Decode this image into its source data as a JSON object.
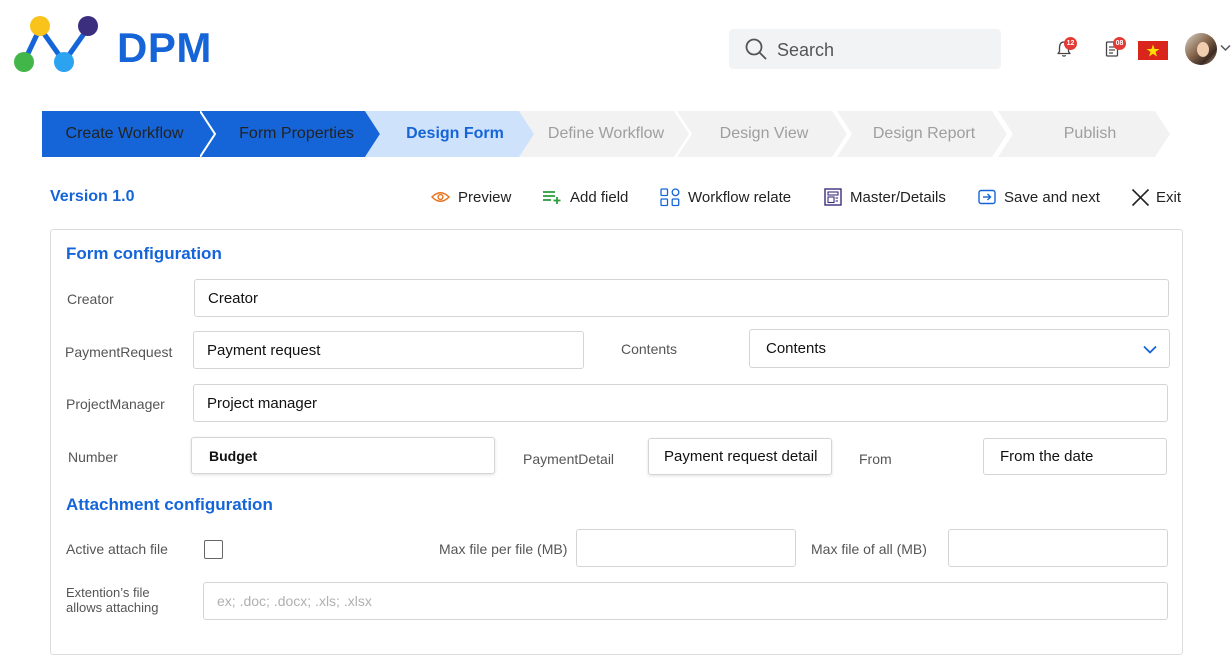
{
  "header": {
    "logo_text": "DPM",
    "search": {
      "placeholder": "Search"
    },
    "notifications": {
      "count": "12"
    },
    "documents": {
      "count": "08"
    },
    "language_flag": "vietnam-flag-icon",
    "user_avatar": "avatar"
  },
  "stepper": [
    {
      "label": "Create Workflow",
      "state": "done"
    },
    {
      "label": "Form Properties",
      "state": "done"
    },
    {
      "label": "Design Form",
      "state": "current"
    },
    {
      "label": "Define Workflow",
      "state": "todo"
    },
    {
      "label": "Design View",
      "state": "todo"
    },
    {
      "label": "Design Report",
      "state": "todo"
    },
    {
      "label": "Publish",
      "state": "todo"
    }
  ],
  "toolbar": {
    "version": "Version 1.0",
    "preview": "Preview",
    "add_field": "Add field",
    "workflow_relate": "Workflow relate",
    "master_details": "Master/Details",
    "save_next": "Save and next",
    "exit": "Exit"
  },
  "form_config": {
    "title": "Form configuration",
    "creator": {
      "label": "Creator",
      "value": "Creator"
    },
    "payment_request": {
      "label": "PaymentRequest",
      "value": "Payment request"
    },
    "contents": {
      "label": "Contents",
      "value": "Contents"
    },
    "project_manager": {
      "label": "ProjectManager",
      "value": "Project manager"
    },
    "number": {
      "label": "Number",
      "value": "Budget"
    },
    "payment_detail": {
      "label": "PaymentDetail",
      "value": "Payment request detail"
    },
    "from": {
      "label": "From",
      "value": "From the date"
    }
  },
  "attachment_config": {
    "title": "Attachment configuration",
    "active_attach": {
      "label": "Active attach file",
      "checked": false
    },
    "max_per_file": {
      "label": "Max file per file (MB)",
      "value": ""
    },
    "max_all": {
      "label": "Max file of all (MB)",
      "value": ""
    },
    "extensions": {
      "label_line1": "Extention’s file",
      "label_line2": "allows attaching",
      "placeholder": "ex; .doc; .docx; .xls; .xlsx"
    }
  },
  "colors": {
    "brand": "#1565d8",
    "step_done": "#1565d8",
    "step_current": "#cfe2fb",
    "step_todo": "#f2f2f2",
    "badge": "#e53935"
  }
}
